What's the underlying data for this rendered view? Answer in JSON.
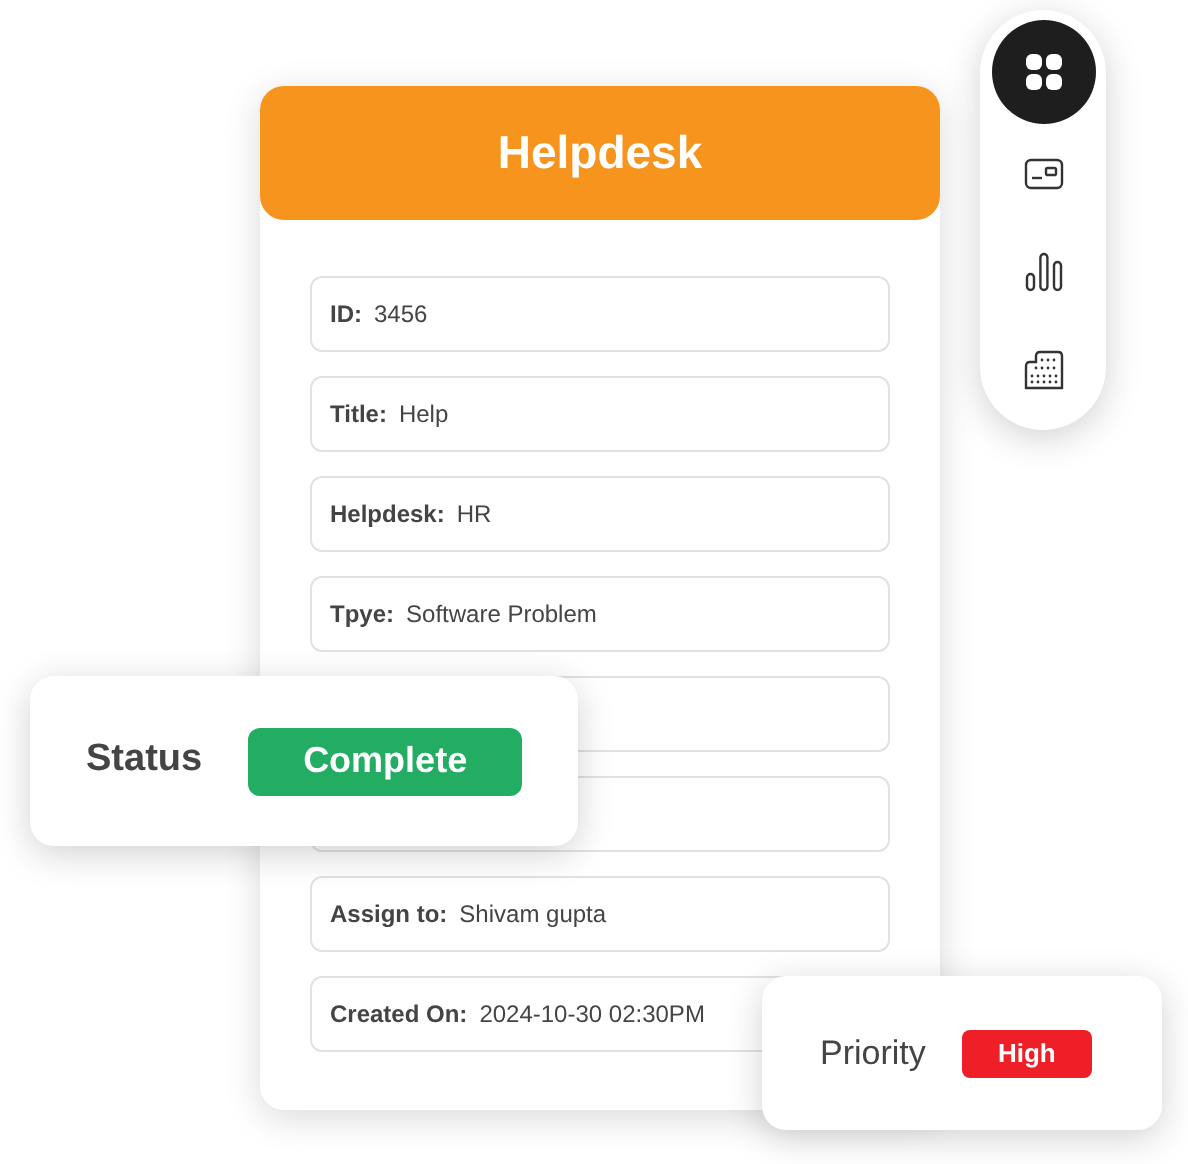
{
  "header": {
    "title": "Helpdesk"
  },
  "fields": [
    {
      "kind": "text",
      "label": "ID:",
      "value": "3456"
    },
    {
      "kind": "text",
      "label": "Title:",
      "value": "Help"
    },
    {
      "kind": "text",
      "label": "Helpdesk:",
      "value": "HR"
    },
    {
      "kind": "text",
      "label": "Tpye:",
      "value": "Software Problem"
    },
    {
      "kind": "blank"
    },
    {
      "kind": "blank"
    },
    {
      "kind": "text",
      "label": "Assign to:",
      "value": "Shivam gupta"
    },
    {
      "kind": "text",
      "label": "Created On:",
      "value": "2024-10-30 02:30PM"
    }
  ],
  "status": {
    "label": "Status",
    "value": "Complete",
    "color": "#22ad62"
  },
  "priority": {
    "label": "Priority",
    "value": "High",
    "color": "#ee1f26"
  },
  "dock": [
    {
      "kind": "grid",
      "selected": true
    },
    {
      "kind": "card",
      "selected": false
    },
    {
      "kind": "bars",
      "selected": false
    },
    {
      "kind": "building",
      "selected": false
    }
  ]
}
